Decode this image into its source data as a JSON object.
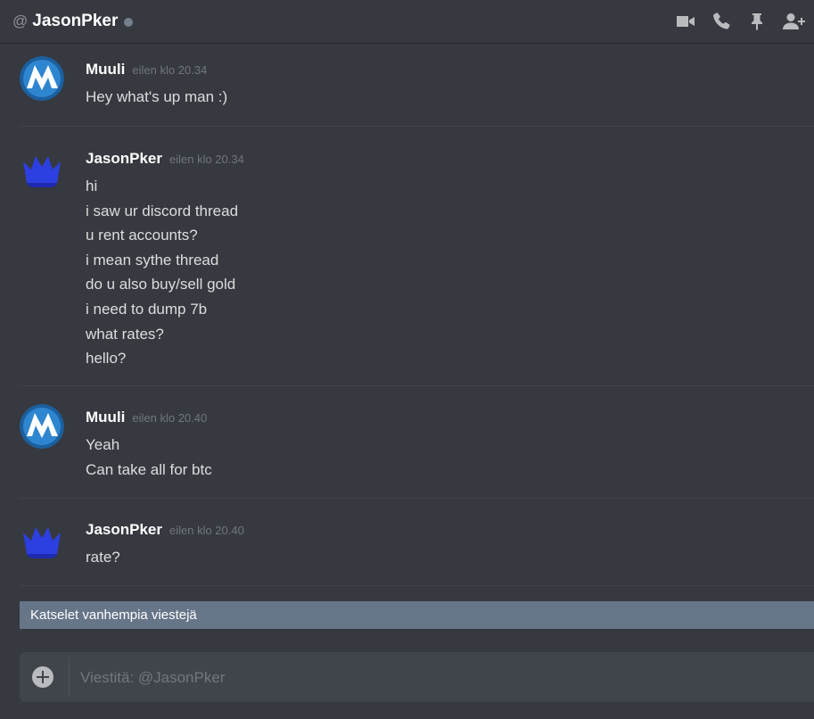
{
  "header": {
    "at_symbol": "@",
    "title": "JasonPker",
    "icons": [
      "video-camera-icon",
      "phone-icon",
      "pin-icon",
      "add-friend-icon"
    ]
  },
  "messages": [
    {
      "author": "Muuli",
      "time": "eilen klo 20.34",
      "avatar": "muuli-avatar",
      "lines": [
        "Hey what's up man :)"
      ]
    },
    {
      "author": "JasonPker",
      "time": "eilen klo 20.34",
      "avatar": "crown-avatar",
      "lines": [
        "hi",
        "i saw ur discord thread",
        "u rent accounts?",
        "i mean sythe thread",
        "do u also buy/sell gold",
        "i need to dump 7b",
        "what rates?",
        "hello?"
      ]
    },
    {
      "author": "Muuli",
      "time": "eilen klo 20.40",
      "avatar": "muuli-avatar",
      "lines": [
        "Yeah",
        "Can take all for btc"
      ]
    },
    {
      "author": "JasonPker",
      "time": "eilen klo 20.40",
      "avatar": "crown-avatar",
      "lines": [
        "rate?"
      ]
    }
  ],
  "older_bar": {
    "label": "Katselet vanhempia viestejä"
  },
  "composer": {
    "placeholder": "Viestitä: @JasonPker"
  },
  "colors": {
    "background": "#36393f",
    "composer": "#40444b",
    "older_bar": "#677588",
    "status_offline": "#747f8d"
  }
}
